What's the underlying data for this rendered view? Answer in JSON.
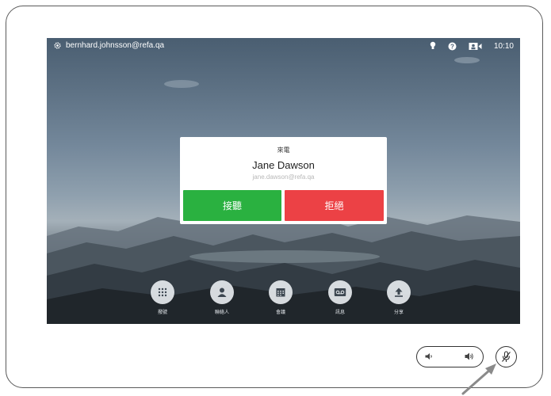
{
  "status_bar": {
    "account": "bernhard.johnsson@refa.qa",
    "time": "10:10"
  },
  "incoming_call": {
    "label": "來電",
    "caller_name": "Jane Dawson",
    "caller_email": "jane.dawson@refa.qa",
    "answer_label": "接聽",
    "decline_label": "拒絕",
    "answer_color": "#2ab140",
    "decline_color": "#ec4145"
  },
  "dock": {
    "items": [
      {
        "label": "撥號",
        "icon": "keypad-icon"
      },
      {
        "label": "聯絡人",
        "icon": "contacts-icon"
      },
      {
        "label": "會議",
        "icon": "calendar-icon"
      },
      {
        "label": "訊息",
        "icon": "voicemail-icon"
      },
      {
        "label": "分享",
        "icon": "share-icon"
      }
    ]
  },
  "hardware": {
    "volume_control": "volume-rocker",
    "mute_control": "mic-mute-icon",
    "pointer": "arrow-pointer-icon"
  }
}
